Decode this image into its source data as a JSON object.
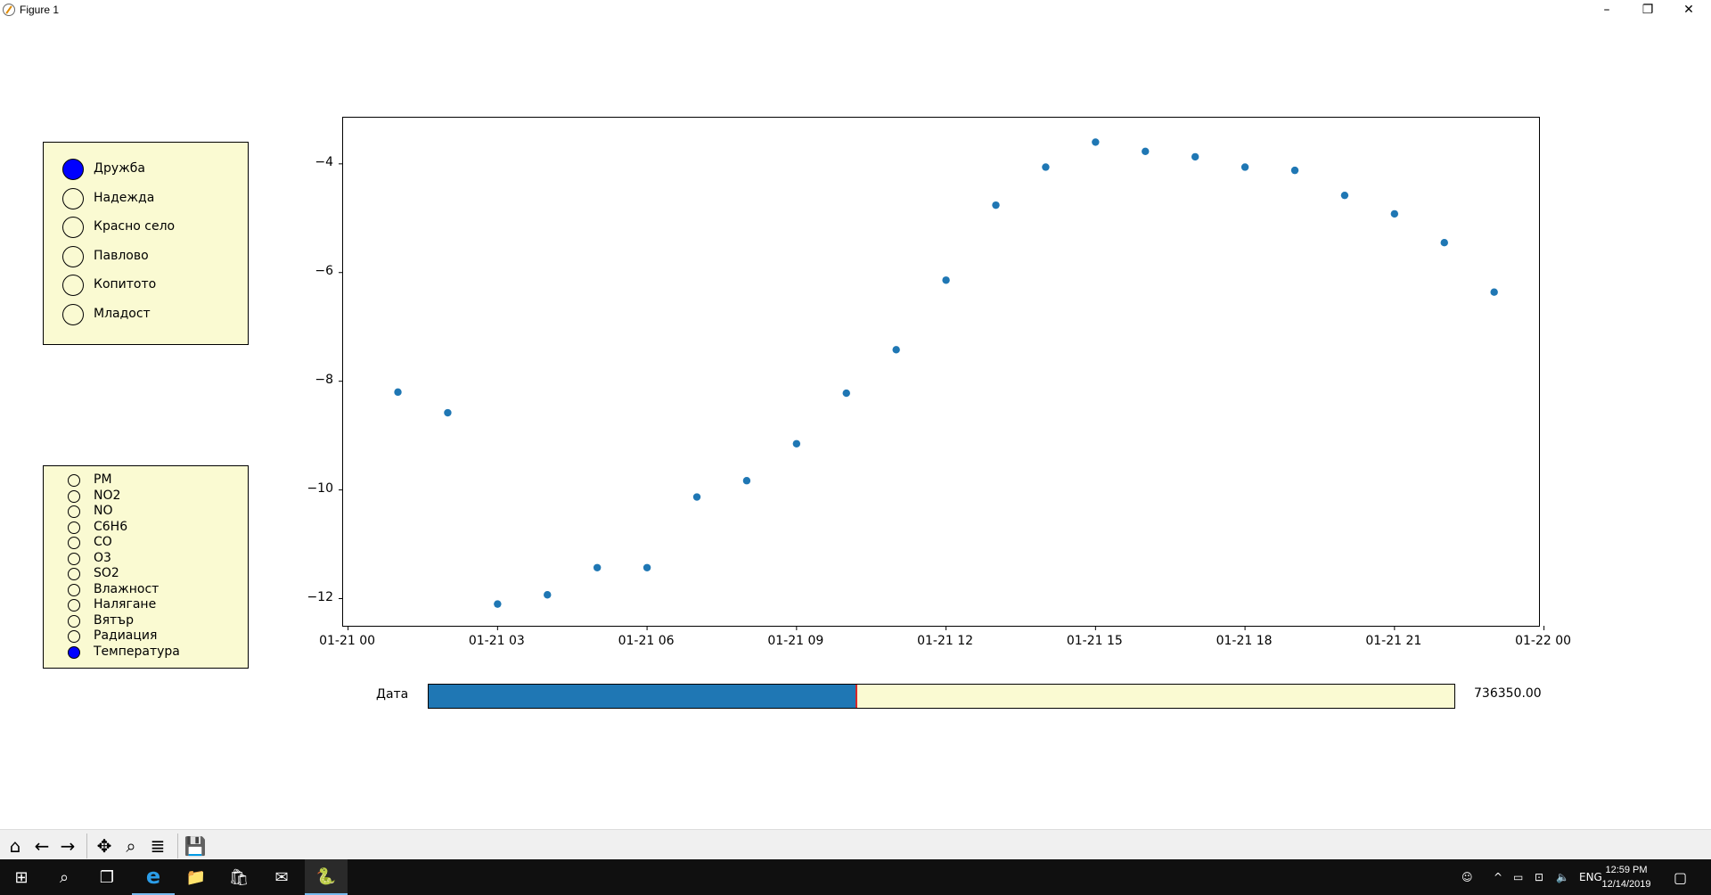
{
  "window": {
    "title": "Figure 1",
    "minimize": "–",
    "restore": "❐",
    "close": "✕"
  },
  "stations": {
    "items": [
      {
        "label": "Дружба",
        "selected": true
      },
      {
        "label": "Надежда",
        "selected": false
      },
      {
        "label": "Красно село",
        "selected": false
      },
      {
        "label": "Павлово",
        "selected": false
      },
      {
        "label": "Копитото",
        "selected": false
      },
      {
        "label": "Младост",
        "selected": false
      }
    ]
  },
  "parameters": {
    "items": [
      {
        "label": "PM",
        "selected": false
      },
      {
        "label": "NO2",
        "selected": false
      },
      {
        "label": "NO",
        "selected": false
      },
      {
        "label": "C6H6",
        "selected": false
      },
      {
        "label": "CO",
        "selected": false
      },
      {
        "label": "O3",
        "selected": false
      },
      {
        "label": "SO2",
        "selected": false
      },
      {
        "label": "Влажност",
        "selected": false
      },
      {
        "label": "Налягане",
        "selected": false
      },
      {
        "label": "Вятър",
        "selected": false
      },
      {
        "label": "Радиация",
        "selected": false
      },
      {
        "label": "Температура",
        "selected": true
      }
    ]
  },
  "chart_data": {
    "type": "scatter",
    "x_labels": [
      "01-21 00",
      "01-21 03",
      "01-21 06",
      "01-21 09",
      "01-21 12",
      "01-21 15",
      "01-21 18",
      "01-21 21",
      "01-22 00"
    ],
    "y_ticks": [
      -4,
      -6,
      -8,
      -10,
      -12
    ],
    "y_tick_labels": [
      "−4",
      "−6",
      "−8",
      "−10",
      "−12"
    ],
    "xlim": [
      -0.1,
      23.9
    ],
    "ylim": [
      -12.5,
      -3.15
    ],
    "x": [
      1,
      2,
      3,
      4,
      5,
      6,
      7,
      8,
      9,
      10,
      11,
      12,
      13,
      14,
      15,
      16,
      17,
      18,
      19,
      20,
      21,
      22,
      23
    ],
    "y": [
      -8.2,
      -8.58,
      -12.1,
      -11.93,
      -11.43,
      -11.43,
      -10.13,
      -9.83,
      -9.15,
      -8.22,
      -7.42,
      -6.14,
      -4.76,
      -4.06,
      -3.6,
      -3.77,
      -3.87,
      -4.06,
      -4.12,
      -4.58,
      -4.92,
      -5.45,
      -6.36
    ],
    "color": "#1f77b4",
    "grid": false
  },
  "slider": {
    "label": "Дата",
    "value_text": "736350.00",
    "fraction": 0.417,
    "fill_color": "#1f77b4",
    "track_color": "#fafad2",
    "marker_color": "#d62728"
  },
  "toolbar": {
    "home_icon": "⌂",
    "back_icon": "←",
    "forward_icon": "→",
    "pan_icon": "✥",
    "zoom_icon": "⌕",
    "configure_icon": "≣",
    "save_icon": "💾"
  },
  "taskbar": {
    "start_icon": "⊞",
    "search_icon": "⌕",
    "taskview_icon": "❐",
    "edge_icon": "e",
    "explorer_icon": "📁",
    "store_icon": "🛍",
    "mail_icon": "✉",
    "python_icon": "🐍",
    "language": "ENG",
    "time": "12:59 PM",
    "date": "12/14/2019"
  }
}
